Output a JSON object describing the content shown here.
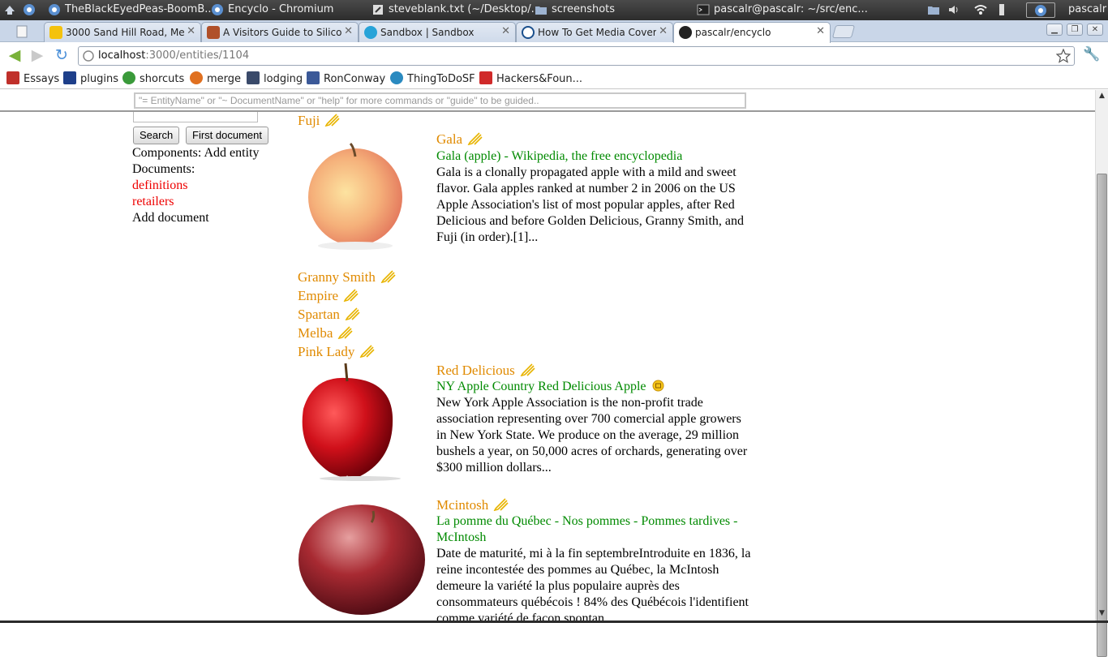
{
  "os_panel": {
    "tasks": [
      "TheBlackEyedPeas-BoomB...",
      "Encyclo - Chromium",
      "steveblank.txt (~/Desktop/...",
      "screenshots",
      "pascalr@pascalr: ~/src/enc..."
    ],
    "user": "pascalr"
  },
  "tabs": [
    {
      "title": "3000 Sand Hill Road, Menlo",
      "favicon_color": "#f4c20d"
    },
    {
      "title": "A Visitors Guide to Silicon V",
      "favicon_color": "#b0502a"
    },
    {
      "title": "Sandbox | Sandbox",
      "favicon_color": "#27a3d8"
    },
    {
      "title": "How To Get Media Coverage",
      "favicon_color": "#1a4f8c"
    },
    {
      "title": "pascalr/encyclo",
      "favicon_color": "#222222"
    }
  ],
  "toolbar": {
    "url_host": "localhost",
    "url_path": ":3000/entities/1104"
  },
  "bookmarks": [
    {
      "label": "Essays",
      "icon": "essays-icon",
      "color": "#c0302a"
    },
    {
      "label": "plugins",
      "icon": "plugins-icon",
      "color": "#1e3f8a"
    },
    {
      "label": "shorcuts",
      "icon": "shortcuts-icon",
      "color": "#3a9a3a"
    },
    {
      "label": "merge",
      "icon": "merge-icon",
      "color": "#e07020"
    },
    {
      "label": "lodging",
      "icon": "lodging-icon",
      "color": "#3a4a6a"
    },
    {
      "label": "RonConway",
      "icon": "ronconway-icon",
      "color": "#3b5998"
    },
    {
      "label": "ThingToDoSF",
      "icon": "thingtodosf-icon",
      "color": "#2a8ac0"
    },
    {
      "label": "Hackers&Foun...",
      "icon": "hackers-icon",
      "color": "#d02a2a"
    }
  ],
  "page": {
    "command_placeholder": "\"= EntityName\" or \"~ DocumentName\" or \"help\" for more commands or \"guide\" to be guided..",
    "search_button": "Search",
    "first_document_button": "First document",
    "components_label": "Components:",
    "add_entity": "Add entity",
    "documents_label": "Documents:",
    "documents": [
      "definitions",
      "retailers"
    ],
    "add_document": "Add document"
  },
  "entities": {
    "fuji": "Fuji",
    "gala": {
      "name": "Gala",
      "doc_title": "Gala (apple) - Wikipedia, the free encyclopedia",
      "doc_body": "Gala is a clonally propagated apple with a mild and sweet flavor. Gala apples ranked at number 2 in 2006 on the US Apple Association's list of most popular apples, after Red Delicious and before Golden Delicious, Granny Smith, and Fuji (in order).[1]..."
    },
    "plain": [
      "Granny Smith",
      "Empire",
      "Spartan",
      "Melba",
      "Pink Lady"
    ],
    "red_delicious": {
      "name": "Red Delicious",
      "doc_title": "NY Apple Country Red Delicious Apple",
      "doc_body": "New York Apple Association is the non-profit trade association representing over 700 comercial apple growers in New York State.  We produce on the average, 29 million bushels a year, on 50,000 acres of orchards, generating over  $300 million dollars..."
    },
    "mcintosh": {
      "name": "Mcintosh",
      "doc_title": "La pomme du Québec - Nos pommes - Pommes tardives - McIntosh",
      "doc_body": "Date de maturité, mi à la fin septembreIntroduite en 1836, la reine incontestée des pommes au Québec, la McIntosh demeure la variété la plus populaire auprès des consommateurs québécois ! 84% des Québécois l'identifient comme variété de façon spontan..."
    }
  }
}
